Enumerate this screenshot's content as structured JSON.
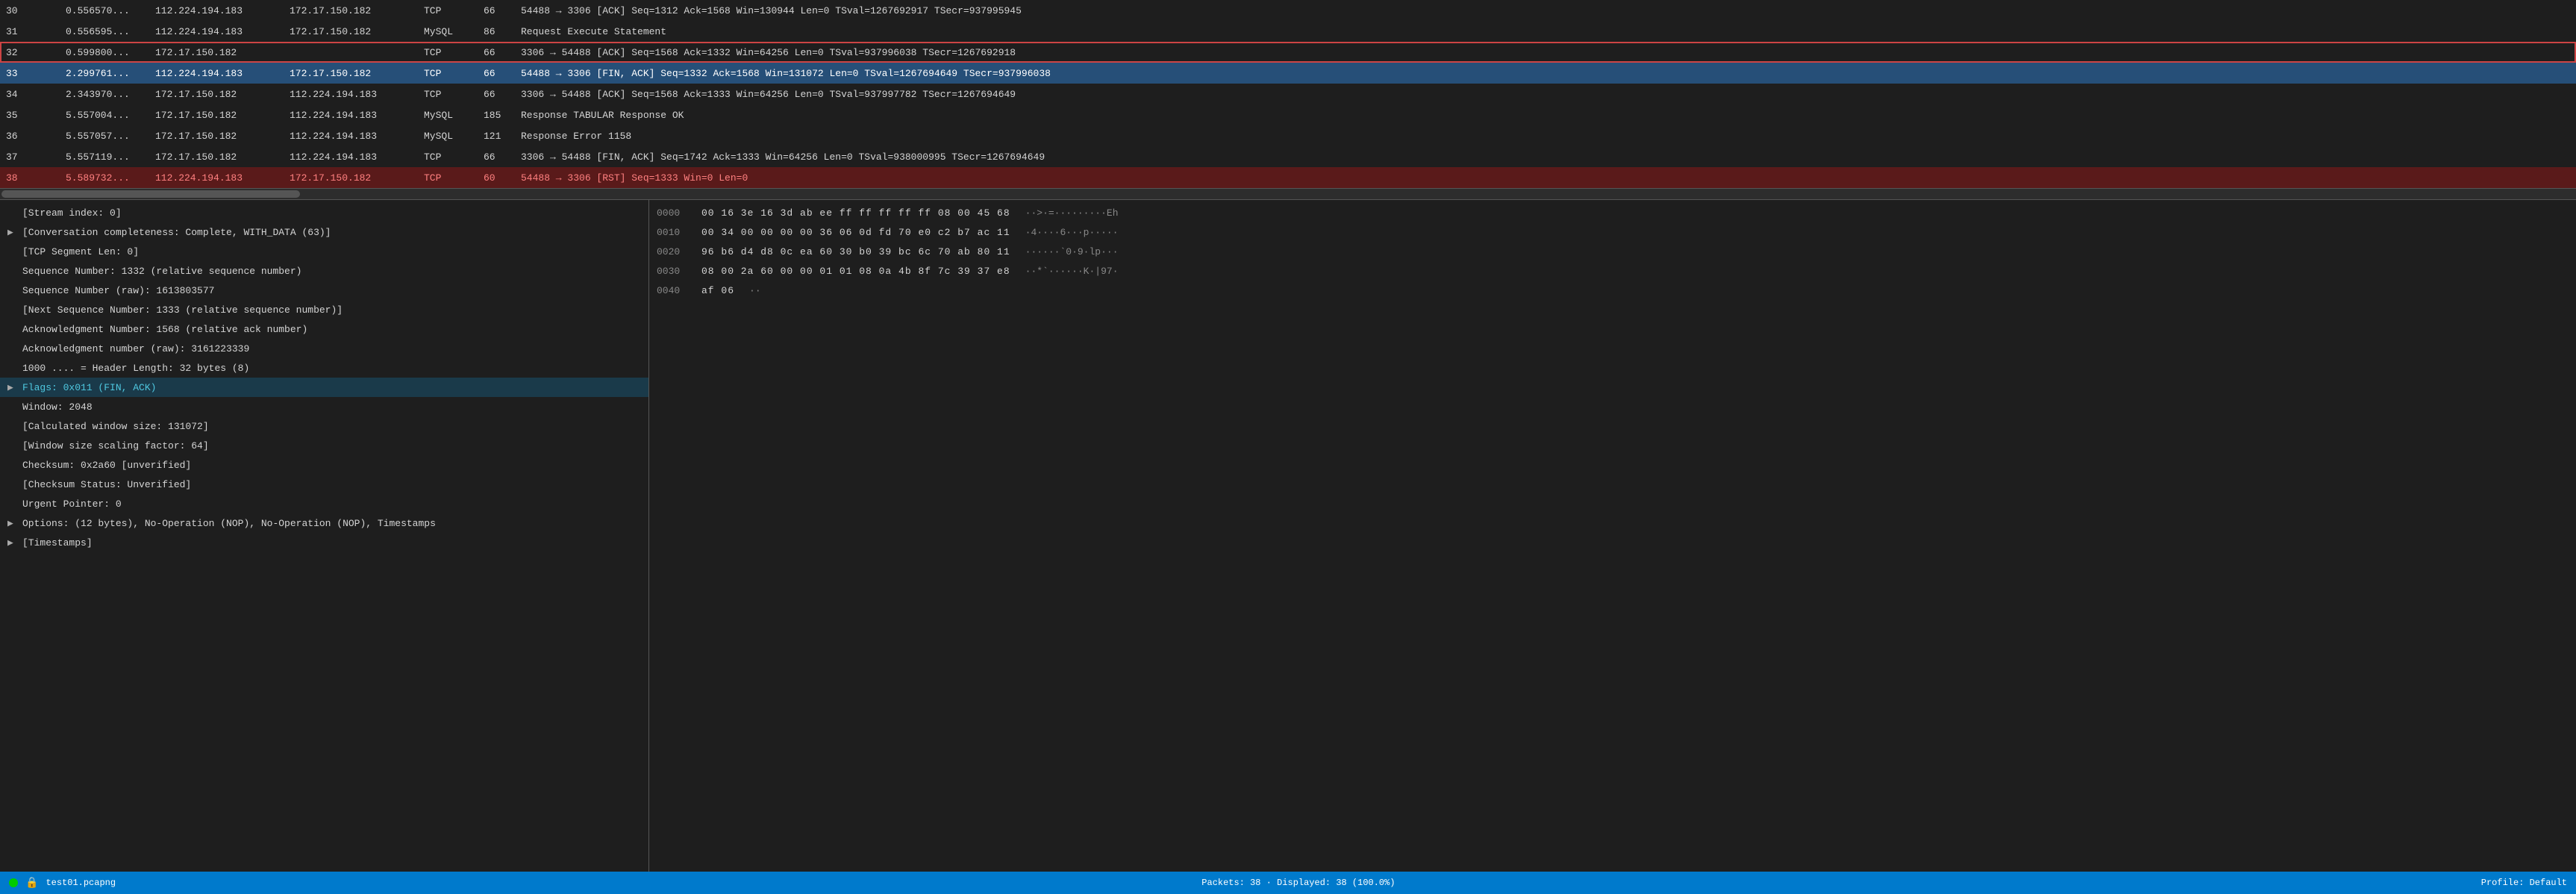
{
  "packetRows": [
    {
      "no": "30",
      "time": "0.556570...",
      "src": "112.224.194.183",
      "dst": "172.17.150.182",
      "proto": "TCP",
      "len": "66",
      "info": "54488 → 3306 [ACK] Seq=1312 Ack=1568 Win=130944 Len=0 TSval=1267692917 TSecr=937995945",
      "style": "normal"
    },
    {
      "no": "31",
      "time": "0.556595...",
      "src": "112.224.194.183",
      "dst": "172.17.150.182",
      "proto": "MySQL",
      "len": "86",
      "info": "Request Execute Statement",
      "style": "normal"
    },
    {
      "no": "32",
      "time": "0.599800...",
      "src": "172.17.150.182",
      "dst": "",
      "proto": "TCP",
      "len": "66",
      "info": "3306 → 54488 [ACK] Seq=1568 Ack=1332 Win=64256 Len=0 TSval=937996038 TSecr=1267692918",
      "style": "outlined"
    },
    {
      "no": "33",
      "time": "2.299761...",
      "src": "112.224.194.183",
      "dst": "172.17.150.182",
      "proto": "TCP",
      "len": "66",
      "info": "54488 → 3306 [FIN, ACK] Seq=1332 Ack=1568 Win=131072 Len=0 TSval=1267694649 TSecr=937996038",
      "style": "selected"
    },
    {
      "no": "34",
      "time": "2.343970...",
      "src": "172.17.150.182",
      "dst": "112.224.194.183",
      "proto": "TCP",
      "len": "66",
      "info": "3306 → 54488 [ACK] Seq=1568 Ack=1333 Win=64256 Len=0 TSval=937997782 TSecr=1267694649",
      "style": "normal"
    },
    {
      "no": "35",
      "time": "5.557004...",
      "src": "172.17.150.182",
      "dst": "112.224.194.183",
      "proto": "MySQL",
      "len": "185",
      "info": "Response TABULAR Response  OK",
      "style": "normal"
    },
    {
      "no": "36",
      "time": "5.557057...",
      "src": "172.17.150.182",
      "dst": "112.224.194.183",
      "proto": "MySQL",
      "len": "121",
      "info": "Response  Error 1158",
      "style": "normal"
    },
    {
      "no": "37",
      "time": "5.557119...",
      "src": "172.17.150.182",
      "dst": "112.224.194.183",
      "proto": "TCP",
      "len": "66",
      "info": "3306 → 54488 [FIN, ACK] Seq=1742 Ack=1333 Win=64256 Len=0 TSval=938000995 TSecr=1267694649",
      "style": "normal"
    },
    {
      "no": "38",
      "time": "5.589732...",
      "src": "112.224.194.183",
      "dst": "172.17.150.182",
      "proto": "TCP",
      "len": "60",
      "info": "54488 → 3306 [RST] Seq=1333 Win=0 Len=0",
      "style": "rst"
    }
  ],
  "detailLines": [
    {
      "text": "[Stream index: 0]",
      "indent": 0,
      "expandable": false,
      "highlighted": false
    },
    {
      "text": "[Conversation completeness: Complete, WITH_DATA (63)]",
      "indent": 0,
      "expandable": true,
      "highlighted": false
    },
    {
      "text": "[TCP Segment Len: 0]",
      "indent": 0,
      "expandable": false,
      "highlighted": false
    },
    {
      "text": "Sequence Number: 1332    (relative sequence number)",
      "indent": 0,
      "expandable": false,
      "highlighted": false
    },
    {
      "text": "Sequence Number (raw): 1613803577",
      "indent": 0,
      "expandable": false,
      "highlighted": false
    },
    {
      "text": "[Next Sequence Number: 1333    (relative sequence number)]",
      "indent": 0,
      "expandable": false,
      "highlighted": false
    },
    {
      "text": "Acknowledgment Number: 1568    (relative ack number)",
      "indent": 0,
      "expandable": false,
      "highlighted": false
    },
    {
      "text": "Acknowledgment number (raw): 3161223339",
      "indent": 0,
      "expandable": false,
      "highlighted": false
    },
    {
      "text": "1000 .... = Header Length: 32 bytes (8)",
      "indent": 0,
      "expandable": false,
      "highlighted": false
    },
    {
      "text": "Flags: 0x011 (FIN, ACK)",
      "indent": 0,
      "expandable": true,
      "highlighted": true
    },
    {
      "text": "Window: 2048",
      "indent": 0,
      "expandable": false,
      "highlighted": false
    },
    {
      "text": "[Calculated window size: 131072]",
      "indent": 0,
      "expandable": false,
      "highlighted": false
    },
    {
      "text": "[Window size scaling factor: 64]",
      "indent": 0,
      "expandable": false,
      "highlighted": false
    },
    {
      "text": "Checksum: 0x2a60 [unverified]",
      "indent": 0,
      "expandable": false,
      "highlighted": false
    },
    {
      "text": "[Checksum Status: Unverified]",
      "indent": 0,
      "expandable": false,
      "highlighted": false
    },
    {
      "text": "Urgent Pointer: 0",
      "indent": 0,
      "expandable": false,
      "highlighted": false
    },
    {
      "text": "Options: (12 bytes), No-Operation (NOP), No-Operation (NOP), Timestamps",
      "indent": 0,
      "expandable": true,
      "highlighted": false
    },
    {
      "text": "[Timestamps]",
      "indent": 0,
      "expandable": true,
      "highlighted": false
    }
  ],
  "hexRows": [
    {
      "offset": "0000",
      "bytes": "00 16 3e 16 3d ab ee ff  ff ff ff ff 08 00 45 68",
      "ascii": "··>·=·········Eh"
    },
    {
      "offset": "0010",
      "bytes": "00 34 00 00 00 00 36 06  0d fd 70 e0 c2 b7 ac 11",
      "ascii": "·4····6···p·····"
    },
    {
      "offset": "0020",
      "bytes": "96 b6 d4 d8 0c ea 60 30  b0 39 bc 6c 70 ab 80 11",
      "ascii": "······`0·9·lp···"
    },
    {
      "offset": "0030",
      "bytes": "08 00 2a 60 00 00 01 01  08 0a 4b 8f 7c 39 37 e8",
      "ascii": "··*`······K·|97·"
    },
    {
      "offset": "0040",
      "bytes": "af 06",
      "ascii": "··"
    }
  ],
  "statusBar": {
    "filename": "test01.pcapng",
    "packets": "Packets: 38 · Displayed: 38 (100.0%)",
    "profile": "Profile: Default"
  }
}
